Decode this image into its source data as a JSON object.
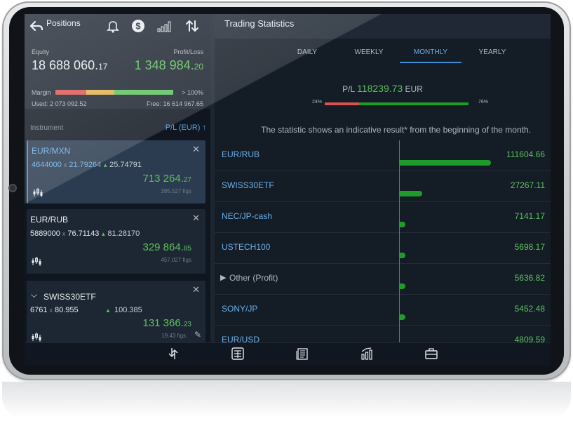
{
  "positions": {
    "title": "Positions",
    "equity_label": "Equity",
    "equity_main": "18 688 060.",
    "equity_dec": "17",
    "pl_label": "Profit/Loss",
    "pl_main": "1 348 984.",
    "pl_dec": "20",
    "margin_label": "Margin",
    "margin_max": "> 100%",
    "used": "Used: 2 073 092.52",
    "free": "Free: 16 614 967.65",
    "instrument_header": "Instrument",
    "pl_header": "P/L (EUR)",
    "margin_segments": [
      {
        "color": "#d9534f",
        "fraction": 0.26
      },
      {
        "color": "#e0b04a",
        "fraction": 0.24
      },
      {
        "color": "#5cc05c",
        "fraction": 0.5
      }
    ],
    "cards": [
      {
        "name": "EUR/MXN",
        "qty": "4644000",
        "x": "x",
        "price1": "21.79264",
        "price2": "25.74791",
        "profit_main": "713 264.",
        "profit_dec": "27",
        "figs": "395.527 figs"
      },
      {
        "name": "EUR/RUB",
        "qty": "5889000",
        "x": "x",
        "price1": "76.71143",
        "price2": "81.28170",
        "profit_main": "329 864.",
        "profit_dec": "85",
        "figs": "457.027 figs"
      },
      {
        "name": "SWISS30ETF",
        "qty": "6761",
        "x": "x",
        "price1": "80.955",
        "price2": "100.385",
        "profit_main": "131 366.",
        "profit_dec": "23",
        "figs": "19.43 figs"
      }
    ]
  },
  "stats": {
    "title": "Trading Statistics",
    "tabs": [
      "DAILY",
      "WEEKLY",
      "MONTHLY",
      "YEARLY"
    ],
    "active_tab": "MONTHLY",
    "pl_prefix": "P/L",
    "pl_value": "118239.73",
    "pl_currency": "EUR",
    "loss_pct": "24%",
    "profit_pct": "76%",
    "loss_fraction": 0.24,
    "note": "The statistic shows an indicative result* from the beginning of the month.",
    "rows": [
      {
        "name": "EUR/RUB",
        "value": "111604.66",
        "amount": 111604.66
      },
      {
        "name": "SWISS30ETF",
        "value": "27267.11",
        "amount": 27267.11
      },
      {
        "name": "NEC/JP-cash",
        "value": "7141.17",
        "amount": 7141.17
      },
      {
        "name": "USTECH100",
        "value": "5698.17",
        "amount": 5698.17
      },
      {
        "name": "Other (Profit)",
        "value": "5636.82",
        "amount": 5636.82
      },
      {
        "name": "SONY/JP",
        "value": "5452.48",
        "amount": 5452.48
      },
      {
        "name": "EUR/USD",
        "value": "4809.59",
        "amount": 4809.59
      }
    ]
  },
  "colors": {
    "profit": "#5cc05c",
    "loss": "#d9534f",
    "accent": "#3a8fd8",
    "bar": "#1f9b2b"
  },
  "icons": {
    "header": [
      "back-arrow-icon",
      "bell-icon",
      "dollar-icon",
      "signal-bars-icon",
      "sort-arrows-icon"
    ],
    "bottom": [
      "transfer-icon",
      "calculator-icon",
      "news-icon",
      "analytics-icon",
      "briefcase-icon"
    ]
  }
}
